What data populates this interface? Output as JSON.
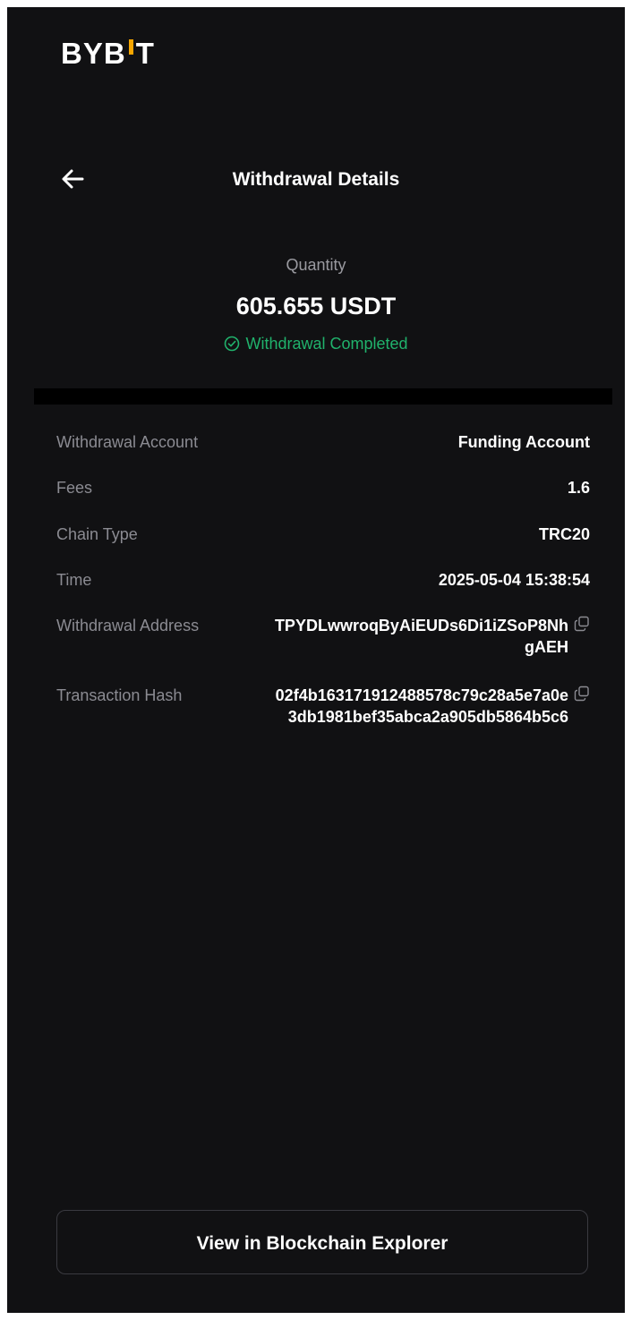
{
  "brand": {
    "logo_left": "BYB",
    "logo_right": "T",
    "accent_color": "#f7a600"
  },
  "header": {
    "back_icon": "arrow-left-icon",
    "title": "Withdrawal Details"
  },
  "summary": {
    "quantity_label": "Quantity",
    "quantity_value": "605.655 USDT",
    "status_icon": "check-circle-icon",
    "status_text": "Withdrawal Completed",
    "status_color": "#20b26c"
  },
  "details": {
    "withdrawal_account": {
      "label": "Withdrawal Account",
      "value": "Funding Account"
    },
    "fees": {
      "label": "Fees",
      "value": "1.6"
    },
    "chain_type": {
      "label": "Chain Type",
      "value": "TRC20"
    },
    "time": {
      "label": "Time",
      "value": "2025-05-04 15:38:54"
    },
    "withdrawal_address": {
      "label": "Withdrawal Address",
      "value": "TPYDLwwroqByAiEUDs6Di1iZSoP8NhgAEH",
      "icon": "copy-icon"
    },
    "transaction_hash": {
      "label": "Transaction Hash",
      "value": "02f4b163171912488578c79c28a5e7a0e3db1981bef35abca2a905db5864b5c6",
      "icon": "copy-icon"
    }
  },
  "footer": {
    "explorer_button": "View in Blockchain Explorer"
  }
}
